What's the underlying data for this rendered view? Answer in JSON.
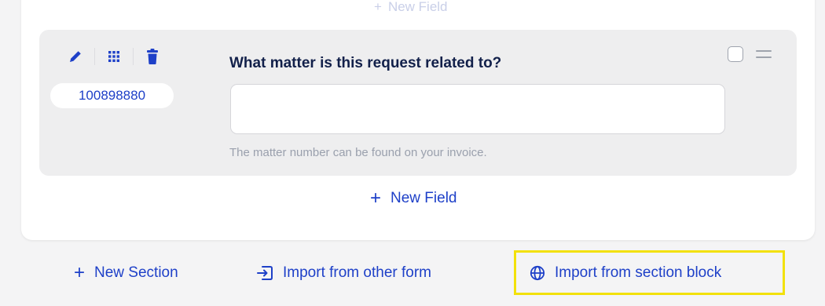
{
  "form": {
    "top_new_field_label": "New Field",
    "field": {
      "id_badge": "100898880",
      "question": "What matter is this request related to?",
      "answer_value": "",
      "hint": "The matter number can be found on your invoice."
    },
    "new_field_label": "New Field"
  },
  "footer": {
    "new_section_label": "New Section",
    "import_form_label": "Import from other form",
    "import_block_label": "Import from section block"
  },
  "icons": {
    "edit": "pencil-icon",
    "grid": "grid-icon",
    "delete": "trash-icon",
    "import_form": "import-icon",
    "import_block": "globe-icon"
  },
  "colors": {
    "accent": "#1e40c8",
    "heading": "#12204a",
    "highlight": "#f2e10a",
    "muted": "#9aa0ad"
  }
}
